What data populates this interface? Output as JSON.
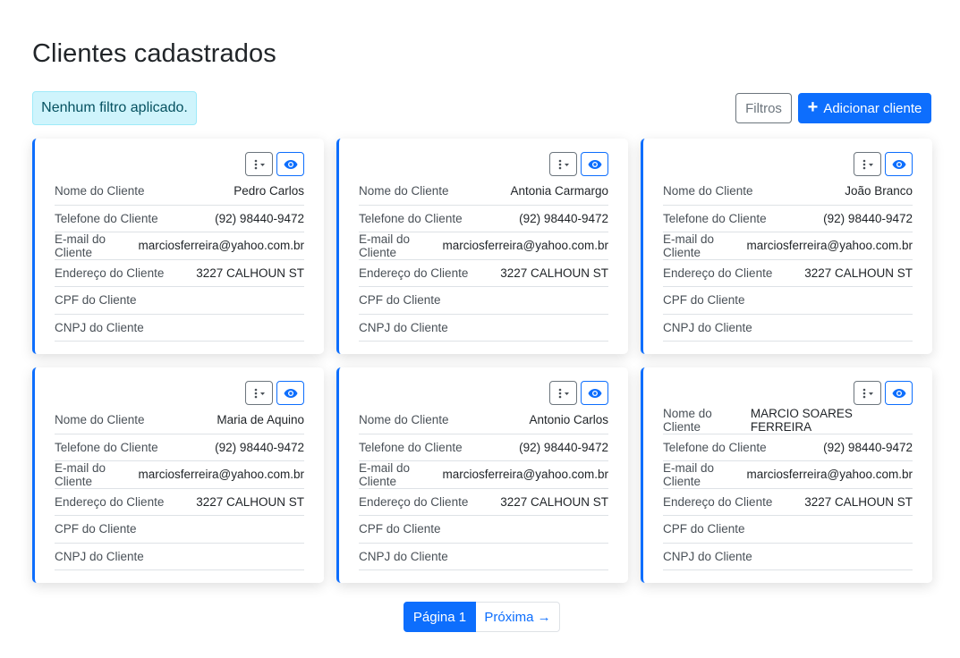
{
  "header": {
    "title": "Clientes cadastrados",
    "filter_status": "Nenhum filtro aplicado.",
    "filters_label": "Filtros",
    "add_label": "Adicionar cliente"
  },
  "field_labels": {
    "nome": "Nome do Cliente",
    "telefone": "Telefone do Cliente",
    "email": "E-mail do Cliente",
    "endereco": "Endereço do Cliente",
    "cpf": "CPF do Cliente",
    "cnpj": "CNPJ do Cliente"
  },
  "clients": [
    {
      "nome": "Pedro Carlos",
      "telefone": "(92) 98440-9472",
      "email": "marciosferreira@yahoo.com.br",
      "endereco": "3227 CALHOUN ST",
      "cpf": "",
      "cnpj": ""
    },
    {
      "nome": "Antonia Carmargo",
      "telefone": "(92) 98440-9472",
      "email": "marciosferreira@yahoo.com.br",
      "endereco": "3227 CALHOUN ST",
      "cpf": "",
      "cnpj": ""
    },
    {
      "nome": "João Branco",
      "telefone": "(92) 98440-9472",
      "email": "marciosferreira@yahoo.com.br",
      "endereco": "3227 CALHOUN ST",
      "cpf": "",
      "cnpj": ""
    },
    {
      "nome": "Maria de Aquino",
      "telefone": "(92) 98440-9472",
      "email": "marciosferreira@yahoo.com.br",
      "endereco": "3227 CALHOUN ST",
      "cpf": "",
      "cnpj": ""
    },
    {
      "nome": "Antonio Carlos",
      "telefone": "(92) 98440-9472",
      "email": "marciosferreira@yahoo.com.br",
      "endereco": "3227 CALHOUN ST",
      "cpf": "",
      "cnpj": ""
    },
    {
      "nome": "MARCIO SOARES FERREIRA",
      "telefone": "(92) 98440-9472",
      "email": "marciosferreira@yahoo.com.br",
      "endereco": "3227 CALHOUN ST",
      "cpf": "",
      "cnpj": ""
    }
  ],
  "pagination": {
    "current": "Página 1",
    "next": "Próxima →"
  },
  "icons": {
    "more": "vertical-dots-icon",
    "dropdown": "caret-down-icon",
    "view": "eye-icon",
    "add": "plus-icon"
  },
  "colors": {
    "primary": "#0d6efd",
    "secondary": "#6c757d",
    "info_bg": "#cff4fc",
    "info_text": "#055160"
  }
}
